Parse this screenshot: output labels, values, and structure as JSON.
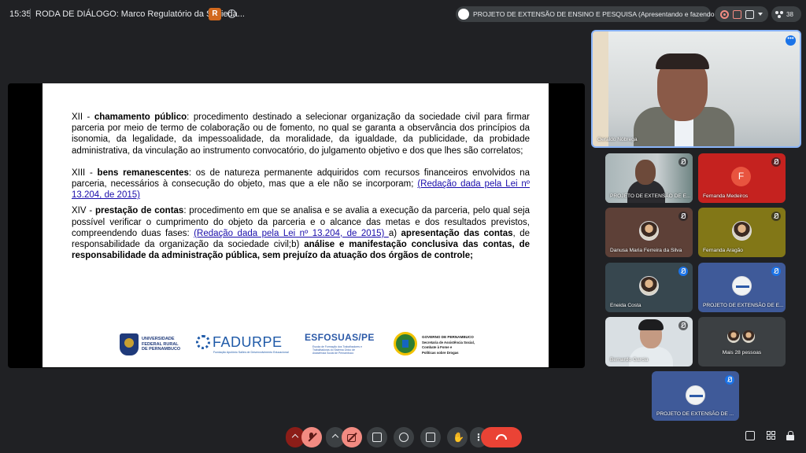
{
  "topbar": {
    "time": "15:35",
    "meeting_title": "RODA DE DIÁLOGO: Marco Regulatório da Socieda...",
    "badge_letter": "R",
    "presenting": "PROJETO DE EXTENSÃO DE ENSINO E PESQUISA (Apresentando e fazendo anotações)",
    "participant_count": "38"
  },
  "slide": {
    "p1_prefix": "XII - ",
    "p1_term": "chamamento público",
    "p1_body": ": procedimento destinado a selecionar organização da sociedade civil para firmar parceria por meio de termo de colaboração ou de fomento, no qual se garanta a observância dos princípios da isonomia, da legalidade, da impessoalidade, da moralidade, da igualdade, da publicidade, da probidade administrativa, da vinculação ao instrumento convocatório, do julgamento objetivo e dos que lhes são correlatos;",
    "p2_prefix": "XIII - ",
    "p2_term": "bens remanescentes",
    "p2_body": ": os de natureza permanente adquiridos com recursos financeiros envolvidos na parceria, necessários à consecução do objeto, mas que a ele não se incorporam; ",
    "p2_link": "(Redação dada pela Lei nº 13.204, de 2015)",
    "p3_prefix": "XIV - ",
    "p3_term": "prestação de contas",
    "p3_body": ": procedimento em que se analisa e se avalia a execução da parceria, pelo qual seja possível verificar o cumprimento do objeto da parceria e o alcance das metas e dos resultados previstos, compreendendo duas fases: ",
    "p3_link": "(Redação dada pela Lei nº 13.204, de 2015) ",
    "p3_a_label": "a) ",
    "p3_a_term": "apresentação das contas",
    "p3_a_body": ", de responsabilidade da organização da sociedade civil;",
    "p3_b_label": "b) ",
    "p3_b_term": "análise e manifestação conclusiva das contas, de responsabilidade da administração pública, sem prejuízo da atuação dos órgãos de controle;",
    "logos": {
      "ufrpe_l1": "UNIVERSIDADE",
      "ufrpe_l2": "FEDERAL RURAL",
      "ufrpe_l3": "DE PERNAMBUCO",
      "fadurpe": "FADURPE",
      "fadurpe_sub": "Fundação Apolônio Salles de Desenvolvimento Educacional",
      "esfosuas": "ESFOSUAS/PE",
      "esfosuas_sub": "Escola de Formação dos Trabalhadores e Trabalhadoras do Sistema Único de Assistência Social de Pernambuco",
      "gov_head": "GOVERNO DE PERNAMBUCO",
      "gov_l1": "Secretaria de Assistência Social,",
      "gov_l2": "Combate à Fome e",
      "gov_l3": "Políticas sobre Drogas"
    }
  },
  "participants": {
    "main": "Geraldo Nóbrega",
    "t1": "PROJETO DE EXTENSÃO DE E...",
    "t2": "Fernanda Medeiros",
    "t2_initial": "F",
    "t3": "Danusa Maria Ferreira da Silva",
    "t4": "Fernanda Aragão",
    "t5": "Eneida Costa",
    "t6": "PROJETO DE EXTENSÃO DE E...",
    "t7": "Bernardo Garcia",
    "t8": "Mais 28 pessoas",
    "t9": "PROJETO DE EXTENSÃO DE ..."
  },
  "colors": {
    "background": "#202124",
    "pill": "#3c4043",
    "accent_blue": "#1a73e8",
    "end_call": "#ea4335",
    "muted_control": "#f28b82"
  },
  "controls": {
    "hand_glyph": "✋",
    "more_glyph": "⋮",
    "more_tile_glyph": "•••"
  },
  "icons": [
    "info-icon",
    "record-icon",
    "annotation-icon",
    "screen-share-off-icon",
    "chevron-down-icon",
    "people-icon",
    "mic-off-icon",
    "camera-off-icon",
    "present-icon",
    "emoji-icon",
    "captions-icon",
    "raise-hand-icon",
    "more-options-icon",
    "end-call-icon",
    "chat-icon",
    "activities-icon",
    "host-controls-icon"
  ]
}
